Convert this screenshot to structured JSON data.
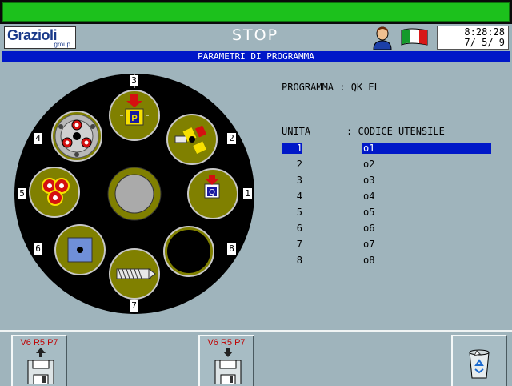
{
  "header": {
    "logo": "Grazioli",
    "logo_sub": "group",
    "status": "STOP",
    "time": "8:28:28",
    "date": "7/ 5/ 9"
  },
  "title": "PARAMETRI DI PROGRAMMA",
  "program": {
    "label": "PROGRAMMA",
    "sep": ":",
    "value": "QK EL"
  },
  "list": {
    "col_unit": "UNITA",
    "col_code": ": CODICE UTENSILE",
    "rows": [
      {
        "unit": "1",
        "code": "o1"
      },
      {
        "unit": "2",
        "code": "o2"
      },
      {
        "unit": "3",
        "code": "o3"
      },
      {
        "unit": "4",
        "code": "o4"
      },
      {
        "unit": "5",
        "code": "o5"
      },
      {
        "unit": "6",
        "code": "o6"
      },
      {
        "unit": "7",
        "code": "o7"
      },
      {
        "unit": "8",
        "code": "o8"
      }
    ],
    "selected": 1
  },
  "wheel": {
    "positions": [
      "1",
      "2",
      "3",
      "4",
      "5",
      "6",
      "7",
      "8"
    ],
    "letters": {
      "p": "P",
      "q": "Q"
    }
  },
  "footer": {
    "save_label": "V6 R5 P7",
    "load_label": "V6 R5 P7"
  },
  "icons": [
    "operator-icon",
    "italian-flag-icon",
    "floppy-save-icon",
    "floppy-load-icon",
    "recycle-bin-icon"
  ],
  "colors": {
    "status_bar": "#1cc11c",
    "title_bar": "#0018c8",
    "background": "#9fb4bc"
  }
}
